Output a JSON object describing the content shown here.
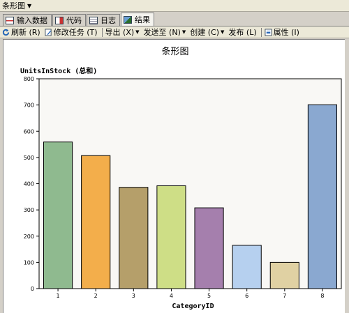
{
  "window": {
    "title": "条形图"
  },
  "tabs": [
    {
      "label": "输入数据",
      "icon": "input-data-icon"
    },
    {
      "label": "代码",
      "icon": "code-icon"
    },
    {
      "label": "日志",
      "icon": "log-icon"
    },
    {
      "label": "结果",
      "icon": "results-icon",
      "active": true
    }
  ],
  "toolbar": {
    "refresh": "刷新 (R)",
    "modify_task": "修改任务 (T)",
    "export": "导出 (X)",
    "send_to": "发送至 (N)",
    "create": "创建 (C)",
    "publish": "发布 (L)",
    "properties": "属性 (I)"
  },
  "chart_data": {
    "type": "bar",
    "title": "条形图",
    "ylabel": "UnitsInStock (总和)",
    "xlabel": "CategoryID",
    "categories": [
      "1",
      "2",
      "3",
      "4",
      "5",
      "6",
      "7",
      "8"
    ],
    "values": [
      559,
      507,
      386,
      392,
      308,
      165,
      100,
      701
    ],
    "colors": [
      "#8fba8f",
      "#f3ae4b",
      "#b59f6a",
      "#cede86",
      "#a57fad",
      "#b6d0ef",
      "#e0d1a3",
      "#8aa8d0"
    ],
    "ylim": [
      0,
      800
    ],
    "yticks": [
      0,
      100,
      200,
      300,
      400,
      500,
      600,
      700,
      800
    ],
    "background": "#f9f8f5",
    "grid": false,
    "legend": "none"
  }
}
